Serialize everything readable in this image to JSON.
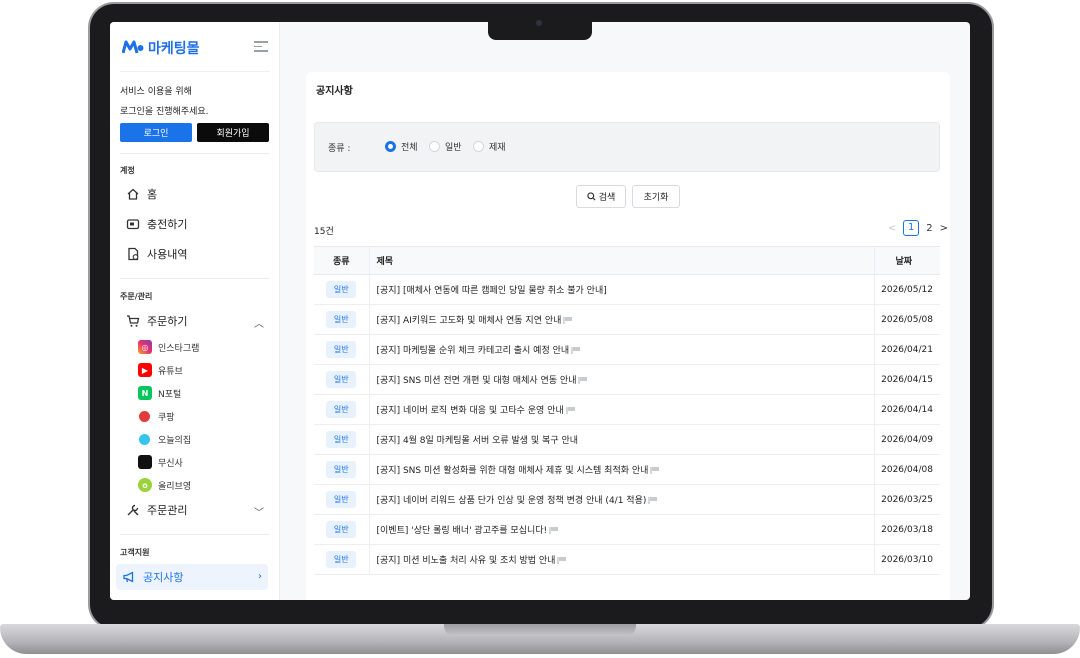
{
  "app": {
    "logo_text": "마케팅몰",
    "brand_color": "#1a73e8"
  },
  "sidebar": {
    "login_prompt_line1": "서비스 이용을 위해",
    "login_prompt_line2": "로그인을 진행해주세요.",
    "login_button": "로그인",
    "join_button": "회원가입",
    "section_account": "계정",
    "account_items": [
      {
        "label": "홈",
        "icon": "home-icon"
      },
      {
        "label": "충전하기",
        "icon": "wallet-icon"
      },
      {
        "label": "사용내역",
        "icon": "history-icon"
      }
    ],
    "section_order": "주문/관리",
    "order_menu_label": "주문하기",
    "order_sub_items": [
      {
        "label": "인스타그램",
        "icon": "instagram-icon"
      },
      {
        "label": "유튜브",
        "icon": "youtube-icon"
      },
      {
        "label": "N포털",
        "icon": "naver-icon"
      },
      {
        "label": "쿠팡",
        "icon": "coupang-icon"
      },
      {
        "label": "오늘의집",
        "icon": "ohouse-icon"
      },
      {
        "label": "무신사",
        "icon": "musinsa-icon"
      },
      {
        "label": "올리브영",
        "icon": "oliveyoung-icon"
      }
    ],
    "manage_menu_label": "주문관리",
    "section_support": "고객지원",
    "active_item_label": "공지사항"
  },
  "main": {
    "page_title": "공지사항",
    "filter": {
      "label": "종류 :",
      "options": [
        "전체",
        "일반",
        "제재"
      ],
      "selected": "전체"
    },
    "search_button": "검색",
    "reset_button": "초기화",
    "result_count": "15건",
    "pagination": {
      "prev": "<",
      "current": "1",
      "next_page": "2",
      "next": ">"
    },
    "table": {
      "headers": [
        "종류",
        "제목",
        "날짜"
      ],
      "rows": [
        {
          "type": "일반",
          "title": "[공지] [매체사 연동에 따른 캠페인 당일 물량 취소 불가 안내]",
          "flag": false,
          "date": "2026/05/12"
        },
        {
          "type": "일반",
          "title": "[공지] AI키워드 고도화 및 매체사 연동 지연 안내",
          "flag": true,
          "date": "2026/05/08"
        },
        {
          "type": "일반",
          "title": "[공지] 마케팅몰 순위 체크 카테고리 출시 예정 안내",
          "flag": true,
          "date": "2026/04/21"
        },
        {
          "type": "일반",
          "title": "[공지] SNS 미션 전면 개편 및 대형 매체사 연동 안내",
          "flag": true,
          "date": "2026/04/15"
        },
        {
          "type": "일반",
          "title": "[공지] 네이버 로직 변화 대응 및 고타수 운영 안내",
          "flag": true,
          "date": "2026/04/14"
        },
        {
          "type": "일반",
          "title": "[공지] 4월 8일 마케팅몰 서버 오류 발생 및 복구 안내",
          "flag": false,
          "date": "2026/04/09"
        },
        {
          "type": "일반",
          "title": "[공지] SNS 미션 활성화를 위한 대형 매체사 제휴 및 시스템 최적화 안내",
          "flag": true,
          "date": "2026/04/08"
        },
        {
          "type": "일반",
          "title": "[공지] 네이버 리워드 상품 단가 인상 및 운영 정책 변경 안내 (4/1 적용)",
          "flag": true,
          "date": "2026/03/25"
        },
        {
          "type": "일반",
          "title": "[이벤트] '상단 롤링 배너' 광고주를 모십니다!",
          "flag": true,
          "date": "2026/03/18"
        },
        {
          "type": "일반",
          "title": "[공지] 미션 비노출 처리 사유 및 조치 방법 안내",
          "flag": true,
          "date": "2026/03/10"
        }
      ]
    }
  }
}
